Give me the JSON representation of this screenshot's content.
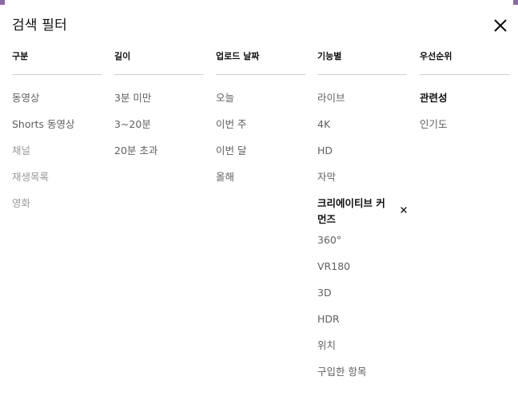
{
  "title": "검색 필터",
  "columns": [
    {
      "header": "구분",
      "options": [
        {
          "label": "동영상",
          "state": "normal"
        },
        {
          "label": "Shorts 동영상",
          "state": "normal"
        },
        {
          "label": "채널",
          "state": "disabled"
        },
        {
          "label": "재생목록",
          "state": "disabled"
        },
        {
          "label": "영화",
          "state": "disabled"
        }
      ]
    },
    {
      "header": "길이",
      "options": [
        {
          "label": "3분 미만",
          "state": "normal"
        },
        {
          "label": "3~20분",
          "state": "normal"
        },
        {
          "label": "20분 초과",
          "state": "normal"
        }
      ]
    },
    {
      "header": "업로드 날짜",
      "options": [
        {
          "label": "오늘",
          "state": "normal"
        },
        {
          "label": "이번 주",
          "state": "normal"
        },
        {
          "label": "이번 달",
          "state": "normal"
        },
        {
          "label": "올해",
          "state": "normal"
        }
      ]
    },
    {
      "header": "기능별",
      "options": [
        {
          "label": "라이브",
          "state": "normal"
        },
        {
          "label": "4K",
          "state": "normal"
        },
        {
          "label": "HD",
          "state": "normal"
        },
        {
          "label": "자막",
          "state": "normal"
        },
        {
          "label": "크리에이티브 커먼즈",
          "state": "selected"
        },
        {
          "label": "360°",
          "state": "normal"
        },
        {
          "label": "VR180",
          "state": "normal"
        },
        {
          "label": "3D",
          "state": "normal"
        },
        {
          "label": "HDR",
          "state": "normal"
        },
        {
          "label": "위치",
          "state": "normal"
        },
        {
          "label": "구입한 항목",
          "state": "normal"
        }
      ]
    },
    {
      "header": "우선순위",
      "options": [
        {
          "label": "관련성",
          "state": "selected"
        },
        {
          "label": "인기도",
          "state": "normal"
        }
      ]
    }
  ],
  "icons": {
    "close": "close-icon",
    "clear": "clear-filter-icon"
  },
  "colors": {
    "text_primary": "#0f0f0f",
    "text_secondary": "#606060",
    "text_disabled": "#9a9a9a",
    "divider": "#cfcfcf"
  }
}
